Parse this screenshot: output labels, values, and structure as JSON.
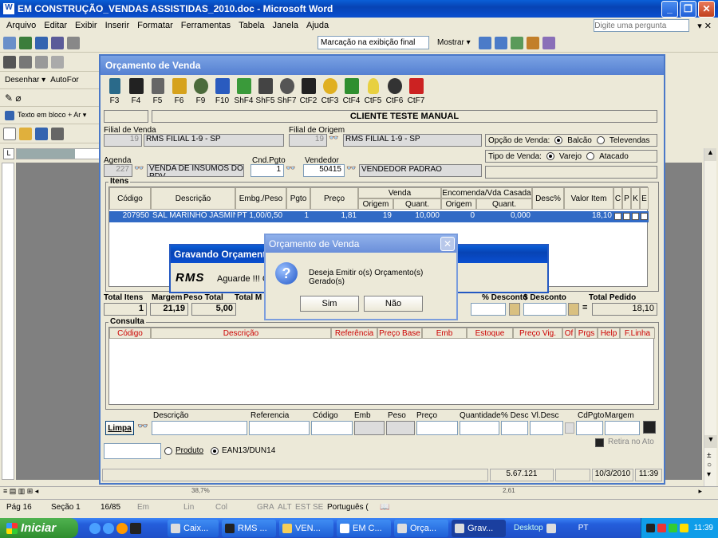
{
  "word": {
    "title": "EM CONSTRUÇÃO_VENDAS ASSISTIDAS_2010.doc - Microsoft Word",
    "menu": [
      "Arquivo",
      "Editar",
      "Exibir",
      "Inserir",
      "Formatar",
      "Ferramentas",
      "Tabela",
      "Janela",
      "Ajuda"
    ],
    "help_placeholder": "Digite uma pergunta",
    "markup_select": "Marcação na exibição final",
    "show_label": "Mostrar ▾",
    "draw_label": "Desenhar ▾",
    "autoshapes_label": "AutoFor",
    "textbox_label": "Texto em bloco + Ar ▾",
    "status": {
      "page": "Pág 16",
      "section": "Seção 1",
      "pages": "16/85",
      "at": "Em",
      "ln": "Lin",
      "col": "Col",
      "grv": "GRA",
      "alt": "ALT",
      "est": "EST",
      "se": "SE",
      "lang": "Português ("
    },
    "doc_frag": {
      "a": "38,7%",
      "b": "2,61"
    }
  },
  "app": {
    "title": "Orçamento de Venda",
    "toolbar": [
      "F3",
      "F4",
      "F5",
      "F6",
      "F9",
      "F10",
      "ShF4",
      "ShF5",
      "ShF7",
      "CtF2",
      "CtF3",
      "CtF4",
      "CtF5",
      "CtF6",
      "CtF7"
    ],
    "client_name": "CLIENTE TESTE MANUAL",
    "filial_venda_label": "Filial de Venda",
    "filial_venda_code": "19",
    "filial_venda_name": "RMS FILIAL 1-9 - SP",
    "filial_origem_label": "Filial de Origem",
    "filial_origem_code": "19",
    "filial_origem_name": "RMS FILIAL 1-9 - SP",
    "opcao_venda_label": "Opção de Venda:",
    "opcao_balcao": "Balcão",
    "opcao_televendas": "Televendas",
    "tipo_venda_label": "Tipo de Venda:",
    "tipo_varejo": "Varejo",
    "tipo_atacado": "Atacado",
    "agenda_label": "Agenda",
    "agenda_code": "227",
    "agenda_desc": "VENDA DE INSUMOS DO PDV",
    "cnd_label": "Cnd.Pgto",
    "cnd_value": "1",
    "vendedor_label": "Vendedor",
    "vendedor_code": "50415",
    "vendedor_name": "VENDEDOR PADRAO",
    "itens_label": "Itens",
    "items_headers": {
      "codigo": "Código",
      "descricao": "Descrição",
      "embg": "Embg./Peso",
      "pgto": "Pgto",
      "preco": "Preço",
      "venda": "Venda",
      "venda_origem": "Origem",
      "venda_quant": "Quant.",
      "encomenda": "Encomenda/Vda Casada",
      "enc_origem": "Origem",
      "enc_quant": "Quant.",
      "desc": "Desc%",
      "valor": "Valor Item",
      "c": "C",
      "p": "P",
      "k": "K",
      "e": "E"
    },
    "items": [
      {
        "codigo": "207950",
        "descricao": "SAL MARINHO JASMINE",
        "embg": "PT 1,00/0,50",
        "pgto": "1",
        "preco": "1,81",
        "origem": "19",
        "quant": "10,000",
        "enc_origem": "0",
        "enc_quant": "0,000",
        "desc": "",
        "valor": "18,10"
      }
    ],
    "totals_labels": {
      "itens": "Total Itens",
      "margem": "Margem",
      "peso": "Peso Total",
      "totalm": "Total M",
      "pdesc": "% Desconto",
      "vdesc": "$ Desconto",
      "pedido": "Total Pedido"
    },
    "totals": {
      "itens": "1",
      "margem": "21,19",
      "peso": "5,00",
      "pedido": "18,10"
    },
    "consulta_label": "Consulta",
    "consulta_headers": [
      "Código",
      "Descrição",
      "Referência",
      "Preço Base",
      "Emb",
      "Estoque",
      "Preço Vig.",
      "Of",
      "Prgs",
      "Help",
      "F.Linha"
    ],
    "search_headers": {
      "descricao": "Descrição",
      "referencia": "Referencia",
      "codigo": "Código",
      "emb": "Emb",
      "peso": "Peso",
      "preco": "Preço",
      "quantidade": "Quantidade",
      "pdesc": "% Desc",
      "vldesc": "Vl.Desc",
      "cdpgto": "CdPgto",
      "margem": "Margem"
    },
    "limpa": "Limpa",
    "retira": "Retira no Ato",
    "produto": "Produto",
    "ean": "EAN13/DUN14",
    "status": {
      "version": "5.67.121",
      "date": "10/3/2010",
      "time": "11:39"
    }
  },
  "progress": {
    "title": "Gravando Orçamento",
    "logo": "RMS",
    "message": "Aguarde !!! Gr"
  },
  "dialog": {
    "title": "Orçamento de Venda",
    "message": "Deseja Emitir o(s) Orçamento(s) Gerado(s)",
    "yes": "Sim",
    "no": "Não"
  },
  "taskbar": {
    "start": "Iniciar",
    "items": [
      "Caix...",
      "RMS ...",
      "VEN...",
      "EM C...",
      "Orça...",
      "Grav..."
    ],
    "desktop": "Desktop",
    "lang": "PT",
    "clock": "11:39"
  }
}
